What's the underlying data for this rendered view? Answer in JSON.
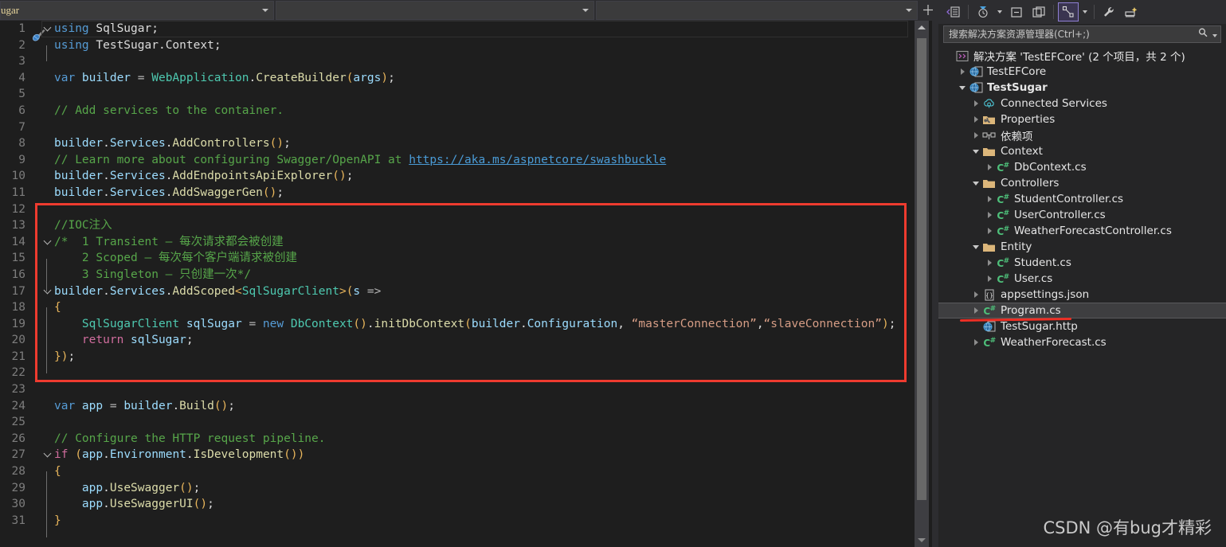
{
  "topbar": {
    "project_combo_value": "ugar",
    "member_combo_value": "",
    "type_combo_value": "",
    "split_button_label": "‖"
  },
  "editor": {
    "lines": [
      {
        "n": "1",
        "marker": "edit-pen",
        "fold": "open",
        "indent": 0,
        "current": true,
        "tokens": [
          {
            "t": "using ",
            "c": "kw"
          },
          {
            "t": "SqlSugar",
            "c": "id"
          },
          {
            "t": ";",
            "c": "pun"
          }
        ]
      },
      {
        "n": "2",
        "fold": "",
        "indent": 1,
        "guide": true,
        "tokens": [
          {
            "t": "using ",
            "c": "kw"
          },
          {
            "t": "TestSugar",
            "c": "id"
          },
          {
            "t": ".",
            "c": "pun"
          },
          {
            "t": "Context",
            "c": "id"
          },
          {
            "t": ";",
            "c": "pun"
          }
        ]
      },
      {
        "n": "3",
        "fold": "",
        "indent": 0,
        "tokens": []
      },
      {
        "n": "4",
        "fold": "",
        "indent": 0,
        "tokens": [
          {
            "t": "var ",
            "c": "kw"
          },
          {
            "t": "builder",
            "c": "var"
          },
          {
            "t": " = ",
            "c": "op"
          },
          {
            "t": "WebApplication",
            "c": "type"
          },
          {
            "t": ".",
            "c": "pun"
          },
          {
            "t": "CreateBuilder",
            "c": "mth"
          },
          {
            "t": "(",
            "c": "par"
          },
          {
            "t": "args",
            "c": "var"
          },
          {
            "t": ")",
            "c": "par"
          },
          {
            "t": ";",
            "c": "pun"
          }
        ]
      },
      {
        "n": "5",
        "fold": "",
        "indent": 0,
        "tokens": []
      },
      {
        "n": "6",
        "fold": "",
        "indent": 0,
        "tokens": [
          {
            "t": "// Add services to the container.",
            "c": "cmt"
          }
        ]
      },
      {
        "n": "7",
        "fold": "",
        "indent": 0,
        "tokens": []
      },
      {
        "n": "8",
        "fold": "",
        "indent": 0,
        "tokens": [
          {
            "t": "builder",
            "c": "var"
          },
          {
            "t": ".",
            "c": "pun"
          },
          {
            "t": "Services",
            "c": "var"
          },
          {
            "t": ".",
            "c": "pun"
          },
          {
            "t": "AddControllers",
            "c": "mth"
          },
          {
            "t": "()",
            "c": "par"
          },
          {
            "t": ";",
            "c": "pun"
          }
        ]
      },
      {
        "n": "9",
        "fold": "",
        "indent": 0,
        "tokens": [
          {
            "t": "// Learn more about configuring Swagger/OpenAPI at ",
            "c": "cmt"
          },
          {
            "t": "https://aka.ms/aspnetcore/swashbuckle",
            "c": "lnk"
          }
        ]
      },
      {
        "n": "10",
        "fold": "",
        "indent": 0,
        "tokens": [
          {
            "t": "builder",
            "c": "var"
          },
          {
            "t": ".",
            "c": "pun"
          },
          {
            "t": "Services",
            "c": "var"
          },
          {
            "t": ".",
            "c": "pun"
          },
          {
            "t": "AddEndpointsApiExplorer",
            "c": "mth"
          },
          {
            "t": "()",
            "c": "par"
          },
          {
            "t": ";",
            "c": "pun"
          }
        ]
      },
      {
        "n": "11",
        "fold": "",
        "indent": 0,
        "tokens": [
          {
            "t": "builder",
            "c": "var"
          },
          {
            "t": ".",
            "c": "pun"
          },
          {
            "t": "Services",
            "c": "var"
          },
          {
            "t": ".",
            "c": "pun"
          },
          {
            "t": "AddSwaggerGen",
            "c": "mth"
          },
          {
            "t": "()",
            "c": "par"
          },
          {
            "t": ";",
            "c": "pun"
          }
        ]
      },
      {
        "n": "12",
        "fold": "",
        "indent": 0,
        "tokens": []
      },
      {
        "n": "13",
        "fold": "",
        "indent": 0,
        "tokens": [
          {
            "t": "//IOC注入",
            "c": "cmt"
          }
        ]
      },
      {
        "n": "14",
        "fold": "open",
        "indent": 0,
        "tokens": [
          {
            "t": "/*  1 Transient – 每次请求都会被创建",
            "c": "cmt"
          }
        ]
      },
      {
        "n": "15",
        "fold": "",
        "indent": 1,
        "guide": true,
        "tokens": [
          {
            "t": "    2 Scoped – 每次每个客户端请求被创建",
            "c": "cmt"
          }
        ]
      },
      {
        "n": "16",
        "fold": "",
        "indent": 1,
        "guide": true,
        "tokens": [
          {
            "t": "    3 Singleton – 只创建一次*/",
            "c": "cmt"
          }
        ]
      },
      {
        "n": "17",
        "fold": "open",
        "indent": 0,
        "tokens": [
          {
            "t": "builder",
            "c": "var"
          },
          {
            "t": ".",
            "c": "pun"
          },
          {
            "t": "Services",
            "c": "var"
          },
          {
            "t": ".",
            "c": "pun"
          },
          {
            "t": "AddScoped",
            "c": "mth"
          },
          {
            "t": "<",
            "c": "par"
          },
          {
            "t": "SqlSugarClient",
            "c": "type"
          },
          {
            "t": ">",
            "c": "par"
          },
          {
            "t": "(",
            "c": "par"
          },
          {
            "t": "s",
            "c": "var"
          },
          {
            "t": " =>",
            "c": "op"
          }
        ]
      },
      {
        "n": "18",
        "fold": "",
        "indent": 1,
        "guide": true,
        "tokens": [
          {
            "t": "{",
            "c": "par"
          }
        ]
      },
      {
        "n": "19",
        "fold": "",
        "indent": 1,
        "guide": true,
        "tokens": [
          {
            "t": "    ",
            "c": "pun"
          },
          {
            "t": "SqlSugarClient",
            "c": "type"
          },
          {
            "t": " sqlSugar",
            "c": "var"
          },
          {
            "t": " = ",
            "c": "op"
          },
          {
            "t": "new ",
            "c": "kw"
          },
          {
            "t": "DbContext",
            "c": "type"
          },
          {
            "t": "()",
            "c": "par"
          },
          {
            "t": ".",
            "c": "pun"
          },
          {
            "t": "initDbContext",
            "c": "mth"
          },
          {
            "t": "(",
            "c": "par"
          },
          {
            "t": "builder",
            "c": "var"
          },
          {
            "t": ".",
            "c": "pun"
          },
          {
            "t": "Configuration",
            "c": "var"
          },
          {
            "t": ", ",
            "c": "pun"
          },
          {
            "t": "“masterConnection”",
            "c": "str"
          },
          {
            "t": ",",
            "c": "pun"
          },
          {
            "t": "“slaveConnection”",
            "c": "str"
          },
          {
            "t": ")",
            "c": "par"
          },
          {
            "t": ";",
            "c": "pun"
          }
        ]
      },
      {
        "n": "20",
        "fold": "",
        "indent": 1,
        "guide": true,
        "tokens": [
          {
            "t": "    ",
            "c": "pun"
          },
          {
            "t": "return ",
            "c": "kwp"
          },
          {
            "t": "sqlSugar",
            "c": "var"
          },
          {
            "t": ";",
            "c": "pun"
          }
        ]
      },
      {
        "n": "21",
        "fold": "",
        "indent": 1,
        "guide": true,
        "tokens": [
          {
            "t": "})",
            "c": "par"
          },
          {
            "t": ";",
            "c": "pun"
          }
        ]
      },
      {
        "n": "22",
        "fold": "",
        "indent": 0,
        "tokens": []
      },
      {
        "n": "23",
        "fold": "",
        "indent": 0,
        "tokens": []
      },
      {
        "n": "24",
        "fold": "",
        "indent": 0,
        "tokens": [
          {
            "t": "var ",
            "c": "kw"
          },
          {
            "t": "app",
            "c": "var"
          },
          {
            "t": " = ",
            "c": "op"
          },
          {
            "t": "builder",
            "c": "var"
          },
          {
            "t": ".",
            "c": "pun"
          },
          {
            "t": "Build",
            "c": "mth"
          },
          {
            "t": "()",
            "c": "par"
          },
          {
            "t": ";",
            "c": "pun"
          }
        ]
      },
      {
        "n": "25",
        "fold": "",
        "indent": 0,
        "tokens": []
      },
      {
        "n": "26",
        "fold": "",
        "indent": 0,
        "tokens": [
          {
            "t": "// Configure the HTTP request pipeline.",
            "c": "cmt"
          }
        ]
      },
      {
        "n": "27",
        "fold": "open",
        "indent": 0,
        "tokens": [
          {
            "t": "if ",
            "c": "kwp"
          },
          {
            "t": "(",
            "c": "par"
          },
          {
            "t": "app",
            "c": "var"
          },
          {
            "t": ".",
            "c": "pun"
          },
          {
            "t": "Environment",
            "c": "var"
          },
          {
            "t": ".",
            "c": "pun"
          },
          {
            "t": "IsDevelopment",
            "c": "mth"
          },
          {
            "t": "())",
            "c": "par"
          }
        ]
      },
      {
        "n": "28",
        "fold": "",
        "indent": 1,
        "guide": true,
        "tokens": [
          {
            "t": "{",
            "c": "par"
          }
        ]
      },
      {
        "n": "29",
        "fold": "",
        "indent": 1,
        "guide": true,
        "tokens": [
          {
            "t": "    ",
            "c": "pun"
          },
          {
            "t": "app",
            "c": "var"
          },
          {
            "t": ".",
            "c": "pun"
          },
          {
            "t": "UseSwagger",
            "c": "mth"
          },
          {
            "t": "()",
            "c": "par"
          },
          {
            "t": ";",
            "c": "pun"
          }
        ]
      },
      {
        "n": "30",
        "fold": "",
        "indent": 1,
        "guide": true,
        "tokens": [
          {
            "t": "    ",
            "c": "pun"
          },
          {
            "t": "app",
            "c": "var"
          },
          {
            "t": ".",
            "c": "pun"
          },
          {
            "t": "UseSwaggerUI",
            "c": "mth"
          },
          {
            "t": "()",
            "c": "par"
          },
          {
            "t": ";",
            "c": "pun"
          }
        ]
      },
      {
        "n": "31",
        "fold": "",
        "indent": 1,
        "guide": true,
        "tokens": [
          {
            "t": "}",
            "c": "par"
          }
        ]
      }
    ],
    "highlight_box_color": "#ee3b2f"
  },
  "solution_explorer": {
    "toolbar_icons": [
      "collapse-all-icon",
      "pending-changes-icon",
      "pending-changes-dropdown",
      "properties-window-icon",
      "show-all-files-icon",
      "solution-explorer-view-icon",
      "view-dropdown",
      "wrench-icon",
      "preview-selected-items-icon"
    ],
    "search_placeholder": "搜索解决方案资源管理器(Ctrl+;)",
    "search_value": "",
    "tree": [
      {
        "label": "解决方案 'TestEFCore' (2 个项目，共 2 个)",
        "depth": 0,
        "expander": "none",
        "icon": "solution-icon",
        "bold": false,
        "selected": false
      },
      {
        "label": "TestEFCore",
        "depth": 1,
        "expander": "collapsed",
        "icon": "project-icon",
        "bold": false,
        "selected": false
      },
      {
        "label": "TestSugar",
        "depth": 1,
        "expander": "expanded",
        "icon": "project-icon",
        "bold": true,
        "selected": false
      },
      {
        "label": "Connected Services",
        "depth": 2,
        "expander": "collapsed",
        "icon": "connected-services-icon",
        "bold": false,
        "selected": false
      },
      {
        "label": "Properties",
        "depth": 2,
        "expander": "collapsed",
        "icon": "properties-folder-icon",
        "bold": false,
        "selected": false
      },
      {
        "label": "依赖项",
        "depth": 2,
        "expander": "collapsed",
        "icon": "dependencies-icon",
        "bold": false,
        "selected": false
      },
      {
        "label": "Context",
        "depth": 2,
        "expander": "expanded",
        "icon": "folder-icon",
        "bold": false,
        "selected": false
      },
      {
        "label": "DbContext.cs",
        "depth": 3,
        "expander": "collapsed",
        "icon": "csharp-file-icon",
        "bold": false,
        "selected": false
      },
      {
        "label": "Controllers",
        "depth": 2,
        "expander": "expanded",
        "icon": "folder-icon",
        "bold": false,
        "selected": false
      },
      {
        "label": "StudentController.cs",
        "depth": 3,
        "expander": "collapsed",
        "icon": "csharp-file-icon",
        "bold": false,
        "selected": false
      },
      {
        "label": "UserController.cs",
        "depth": 3,
        "expander": "collapsed",
        "icon": "csharp-file-icon",
        "bold": false,
        "selected": false
      },
      {
        "label": "WeatherForecastController.cs",
        "depth": 3,
        "expander": "collapsed",
        "icon": "csharp-file-icon",
        "bold": false,
        "selected": false
      },
      {
        "label": "Entity",
        "depth": 2,
        "expander": "expanded",
        "icon": "folder-icon",
        "bold": false,
        "selected": false
      },
      {
        "label": "Student.cs",
        "depth": 3,
        "expander": "collapsed",
        "icon": "csharp-file-icon",
        "bold": false,
        "selected": false
      },
      {
        "label": "User.cs",
        "depth": 3,
        "expander": "collapsed",
        "icon": "csharp-file-icon",
        "bold": false,
        "selected": false
      },
      {
        "label": "appsettings.json",
        "depth": 2,
        "expander": "collapsed",
        "icon": "json-file-icon",
        "bold": false,
        "selected": false
      },
      {
        "label": "Program.cs",
        "depth": 2,
        "expander": "collapsed",
        "icon": "csharp-file-icon",
        "bold": false,
        "selected": true
      },
      {
        "label": "TestSugar.http",
        "depth": 2,
        "expander": "none",
        "icon": "http-file-icon",
        "bold": false,
        "selected": false
      },
      {
        "label": "WeatherForecast.cs",
        "depth": 2,
        "expander": "collapsed",
        "icon": "csharp-file-icon",
        "bold": false,
        "selected": false
      }
    ]
  },
  "watermark": {
    "text": "CSDN @有bug才精彩"
  },
  "colors": {
    "editor_bg": "#1e1e1e",
    "panel_bg": "#252526",
    "chrome_bg": "#2d2d30",
    "selection_bg": "#3e3e40",
    "annotation_red": "#ee3b2f",
    "comment_green": "#57a64a",
    "keyword_blue": "#569cd6",
    "type_teal": "#4ec9b0",
    "method_yellow": "#dcdcaa",
    "string_orange": "#d69d85"
  }
}
